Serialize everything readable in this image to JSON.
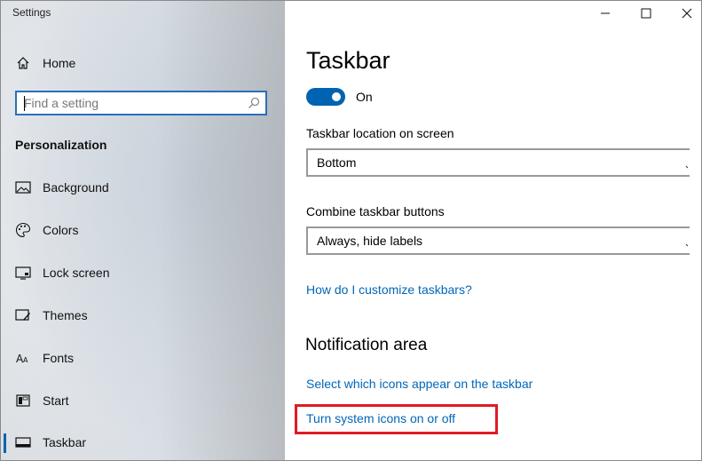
{
  "window": {
    "title": "Settings",
    "minimize_icon": "minimize-icon",
    "maximize_icon": "maximize-icon",
    "close_icon": "close-icon"
  },
  "sidebar": {
    "home_label": "Home",
    "search": {
      "placeholder": "Find a setting",
      "icon": "search-icon"
    },
    "section_title": "Personalization",
    "items": [
      {
        "label": "Background",
        "icon": "picture-icon"
      },
      {
        "label": "Colors",
        "icon": "palette-icon"
      },
      {
        "label": "Lock screen",
        "icon": "lock-screen-icon"
      },
      {
        "label": "Themes",
        "icon": "themes-icon"
      },
      {
        "label": "Fonts",
        "icon": "fonts-icon"
      },
      {
        "label": "Start",
        "icon": "start-icon"
      },
      {
        "label": "Taskbar",
        "icon": "taskbar-icon",
        "active": true
      }
    ]
  },
  "main": {
    "title": "Taskbar",
    "toggle": {
      "state_label": "On",
      "on": true,
      "accent": "#0063b1"
    },
    "location": {
      "label": "Taskbar location on screen",
      "value": "Bottom"
    },
    "combine": {
      "label": "Combine taskbar buttons",
      "value": "Always, hide labels"
    },
    "help_link": "How do I customize taskbars?",
    "notification": {
      "title": "Notification area",
      "link_icons": "Select which icons appear on the taskbar",
      "link_system": "Turn system icons on or off"
    },
    "link_color": "#0067b8",
    "highlight_color": "#e01b24"
  }
}
